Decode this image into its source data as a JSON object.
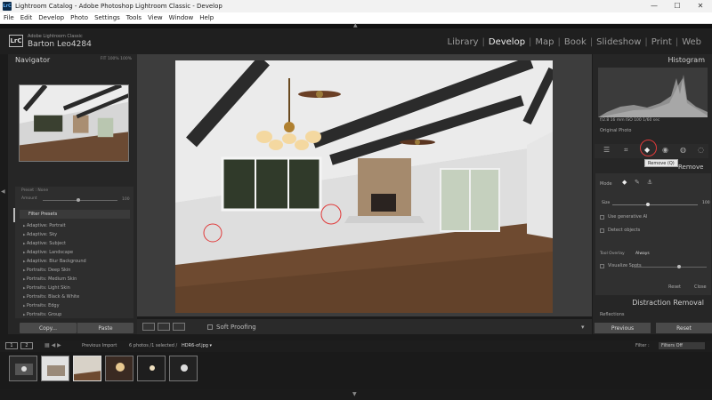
{
  "window": {
    "title": "Lightroom Catalog - Adobe Photoshop Lightroom Classic - Develop",
    "app_icon": "LrC",
    "controls": [
      "—",
      "☐",
      "✕"
    ]
  },
  "menu": [
    "File",
    "Edit",
    "Develop",
    "Photo",
    "Settings",
    "Tools",
    "View",
    "Window",
    "Help"
  ],
  "identity": {
    "badge": "LrC",
    "line1": "Adobe Lightroom Classic",
    "line2": "Barton Leo4284"
  },
  "modules": [
    "Library",
    "Develop",
    "Map",
    "Book",
    "Slideshow",
    "Print",
    "Web"
  ],
  "active_module": "Develop",
  "navigator": {
    "title": "Navigator",
    "zoom": "FIT  100%  100%"
  },
  "presets": {
    "preset_label": "Preset : None",
    "amount_label": "Amount",
    "amount_value": "100",
    "filter_title": "Filter Presets",
    "items": [
      "Adaptive: Portrait",
      "Adaptive: Sky",
      "Adaptive: Subject",
      "Adaptive: Landscape",
      "Adaptive: Blur Background",
      "Portraits: Deep Skin",
      "Portraits: Medium Skin",
      "Portraits: Light Skin",
      "Portraits: Black & White",
      "Portraits: Edgy",
      "Portraits: Group"
    ]
  },
  "left_buttons": {
    "copy": "Copy...",
    "paste": "Paste"
  },
  "toolbar": {
    "soft_proofing": "Soft Proofing"
  },
  "histogram": {
    "title": "Histogram",
    "info": "f/2.8   16 mm   ISO 100   1/60 sec",
    "original_photo": "Original Photo"
  },
  "remove_tool": {
    "tooltip": "Remove (Q)",
    "title": "Remove",
    "mode_label": "Mode",
    "size_label": "Size",
    "size_max": "100",
    "use_generative_ai": "Use generative AI",
    "detect_objects": "Detect objects",
    "tool_overlay_label": "Tool Overlay",
    "tool_overlay_value": "Always",
    "visualize_spots": "Visualize Spots",
    "reset": "Reset",
    "close": "Close"
  },
  "distraction_removal": {
    "title": "Distraction Removal",
    "reflections": "Reflections"
  },
  "right_buttons": {
    "previous": "Previous",
    "reset": "Reset"
  },
  "filmstrip": {
    "pages": [
      "1",
      "2"
    ],
    "source": "Previous Import",
    "count": "6 photos /1 selected /",
    "file": "HDR6-of.jpg ▾",
    "filter_label": "Filter :",
    "filter_value": "Filters Off"
  },
  "colors": {
    "accent_red": "#e03a3a",
    "panel_bg": "#262626"
  },
  "icons": [
    "minimize-icon",
    "maximize-icon",
    "close-icon",
    "remove-eraser-icon",
    "crop-icon",
    "heal-icon",
    "red-eye-icon",
    "mask-icon"
  ]
}
